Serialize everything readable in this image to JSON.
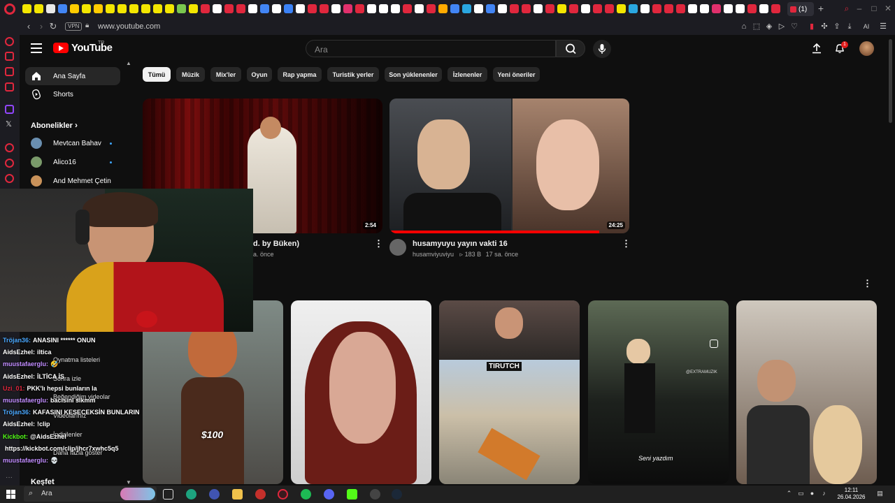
{
  "browser": {
    "url": "www.youtube.com",
    "vpn_label": "VPN",
    "active_tab_label": "(1)",
    "new_tab": "+",
    "ai_label": "AI"
  },
  "header": {
    "logo_text": "YouTube",
    "logo_region": "TR",
    "search_placeholder": "Ara",
    "notification_count": "1"
  },
  "sidebar": {
    "items": [
      {
        "label": "Ana Sayfa"
      },
      {
        "label": "Shorts"
      }
    ],
    "subscriptions_title": "Abonelikler",
    "subscriptions": [
      {
        "name": "Mevtcan Bahav",
        "color": "#6a8fb0"
      },
      {
        "name": "Alico16",
        "color": "#7a9a6a"
      },
      {
        "name": "And Mehmet Çetin",
        "color": "#c9925a"
      }
    ],
    "explore_title": "Keşfet",
    "under_overlay_items": [
      "Oynatma listeleri",
      "Sonra izle",
      "Beğendiğim videolar",
      "Videolarınız",
      "İndirilenler",
      "Daha fazla göster"
    ]
  },
  "chips": [
    {
      "label": "Tümü",
      "active": true
    },
    {
      "label": "Müzik"
    },
    {
      "label": "Mix'ler"
    },
    {
      "label": "Oyun"
    },
    {
      "label": "Rap yapma"
    },
    {
      "label": "Turistik yerler"
    },
    {
      "label": "Son yüklenenler"
    },
    {
      "label": "İzlenenler"
    },
    {
      "label": "Yeni öneriler"
    }
  ],
  "videos": [
    {
      "title_visible": "d. by Büken)",
      "meta_visible": "a. önce",
      "duration": "2:54"
    },
    {
      "title": "husamyuyu yayın vakti 16",
      "channel": "husamviyuviyu",
      "views": "183 B",
      "age": "17 sa. önce",
      "duration": "24:25"
    }
  ],
  "shorts": [
    {
      "overlay_text": "$100"
    },
    {
      "overlay_text": ""
    },
    {
      "overlay_text": "TIRUTCH"
    },
    {
      "overlay_text": "Seni yazdım",
      "watermark": "@EXTRAMUZIK"
    },
    {
      "overlay_text": ""
    }
  ],
  "chat": [
    {
      "user": "Tröjan36:",
      "msg": "ANASINI ****** ONUN",
      "color": "#4aa8ff"
    },
    {
      "user": "AidsEzhel:",
      "msg": "iltica",
      "color": "#ffffff"
    },
    {
      "user": "muustafaerglu:",
      "msg": "🤣",
      "color": "#c18cff"
    },
    {
      "user": "AidsEzhel:",
      "msg": "İLTİCA İS",
      "color": "#ffffff"
    },
    {
      "user": "Uzi_01:",
      "msg": "PKK'lı hepsi bunların la",
      "color": "#e0273d"
    },
    {
      "user": "muustafaerglu:",
      "msg": "bacisini sikmm",
      "color": "#c18cff"
    },
    {
      "user": "Tröjan36:",
      "msg": "KAFASINI KESECEKSİN BUNLARIN",
      "color": "#4aa8ff"
    },
    {
      "user": "AidsEzhel:",
      "msg": "!clip",
      "color": "#ffffff"
    },
    {
      "user": "Kickbot:",
      "msg": "@AidsEzhel",
      "color": "#53fc18"
    },
    {
      "user": "",
      "msg": "https://kickbot.com/clip/jhcr7xwhc5q5",
      "color": "#ffffff"
    },
    {
      "user": "muustafaerglu:",
      "msg": "💀",
      "color": "#c18cff"
    }
  ],
  "taskbar": {
    "search_label": "Ara",
    "time": "12:11",
    "date": "26.04.2026"
  }
}
